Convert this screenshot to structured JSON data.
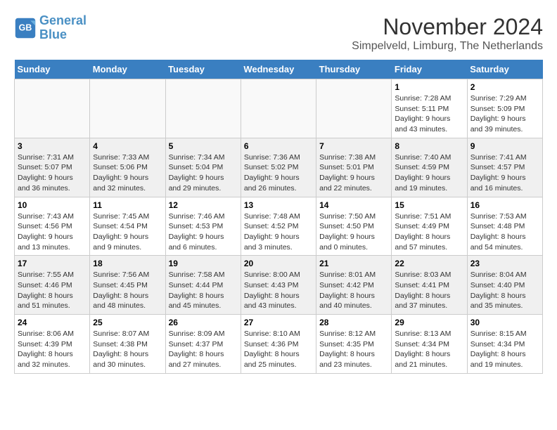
{
  "header": {
    "logo_line1": "General",
    "logo_line2": "Blue",
    "month_title": "November 2024",
    "location": "Simpelveld, Limburg, The Netherlands"
  },
  "weekdays": [
    "Sunday",
    "Monday",
    "Tuesday",
    "Wednesday",
    "Thursday",
    "Friday",
    "Saturday"
  ],
  "weeks": [
    [
      {
        "day": "",
        "info": ""
      },
      {
        "day": "",
        "info": ""
      },
      {
        "day": "",
        "info": ""
      },
      {
        "day": "",
        "info": ""
      },
      {
        "day": "",
        "info": ""
      },
      {
        "day": "1",
        "info": "Sunrise: 7:28 AM\nSunset: 5:11 PM\nDaylight: 9 hours\nand 43 minutes."
      },
      {
        "day": "2",
        "info": "Sunrise: 7:29 AM\nSunset: 5:09 PM\nDaylight: 9 hours\nand 39 minutes."
      }
    ],
    [
      {
        "day": "3",
        "info": "Sunrise: 7:31 AM\nSunset: 5:07 PM\nDaylight: 9 hours\nand 36 minutes."
      },
      {
        "day": "4",
        "info": "Sunrise: 7:33 AM\nSunset: 5:06 PM\nDaylight: 9 hours\nand 32 minutes."
      },
      {
        "day": "5",
        "info": "Sunrise: 7:34 AM\nSunset: 5:04 PM\nDaylight: 9 hours\nand 29 minutes."
      },
      {
        "day": "6",
        "info": "Sunrise: 7:36 AM\nSunset: 5:02 PM\nDaylight: 9 hours\nand 26 minutes."
      },
      {
        "day": "7",
        "info": "Sunrise: 7:38 AM\nSunset: 5:01 PM\nDaylight: 9 hours\nand 22 minutes."
      },
      {
        "day": "8",
        "info": "Sunrise: 7:40 AM\nSunset: 4:59 PM\nDaylight: 9 hours\nand 19 minutes."
      },
      {
        "day": "9",
        "info": "Sunrise: 7:41 AM\nSunset: 4:57 PM\nDaylight: 9 hours\nand 16 minutes."
      }
    ],
    [
      {
        "day": "10",
        "info": "Sunrise: 7:43 AM\nSunset: 4:56 PM\nDaylight: 9 hours\nand 13 minutes."
      },
      {
        "day": "11",
        "info": "Sunrise: 7:45 AM\nSunset: 4:54 PM\nDaylight: 9 hours\nand 9 minutes."
      },
      {
        "day": "12",
        "info": "Sunrise: 7:46 AM\nSunset: 4:53 PM\nDaylight: 9 hours\nand 6 minutes."
      },
      {
        "day": "13",
        "info": "Sunrise: 7:48 AM\nSunset: 4:52 PM\nDaylight: 9 hours\nand 3 minutes."
      },
      {
        "day": "14",
        "info": "Sunrise: 7:50 AM\nSunset: 4:50 PM\nDaylight: 9 hours\nand 0 minutes."
      },
      {
        "day": "15",
        "info": "Sunrise: 7:51 AM\nSunset: 4:49 PM\nDaylight: 8 hours\nand 57 minutes."
      },
      {
        "day": "16",
        "info": "Sunrise: 7:53 AM\nSunset: 4:48 PM\nDaylight: 8 hours\nand 54 minutes."
      }
    ],
    [
      {
        "day": "17",
        "info": "Sunrise: 7:55 AM\nSunset: 4:46 PM\nDaylight: 8 hours\nand 51 minutes."
      },
      {
        "day": "18",
        "info": "Sunrise: 7:56 AM\nSunset: 4:45 PM\nDaylight: 8 hours\nand 48 minutes."
      },
      {
        "day": "19",
        "info": "Sunrise: 7:58 AM\nSunset: 4:44 PM\nDaylight: 8 hours\nand 45 minutes."
      },
      {
        "day": "20",
        "info": "Sunrise: 8:00 AM\nSunset: 4:43 PM\nDaylight: 8 hours\nand 43 minutes."
      },
      {
        "day": "21",
        "info": "Sunrise: 8:01 AM\nSunset: 4:42 PM\nDaylight: 8 hours\nand 40 minutes."
      },
      {
        "day": "22",
        "info": "Sunrise: 8:03 AM\nSunset: 4:41 PM\nDaylight: 8 hours\nand 37 minutes."
      },
      {
        "day": "23",
        "info": "Sunrise: 8:04 AM\nSunset: 4:40 PM\nDaylight: 8 hours\nand 35 minutes."
      }
    ],
    [
      {
        "day": "24",
        "info": "Sunrise: 8:06 AM\nSunset: 4:39 PM\nDaylight: 8 hours\nand 32 minutes."
      },
      {
        "day": "25",
        "info": "Sunrise: 8:07 AM\nSunset: 4:38 PM\nDaylight: 8 hours\nand 30 minutes."
      },
      {
        "day": "26",
        "info": "Sunrise: 8:09 AM\nSunset: 4:37 PM\nDaylight: 8 hours\nand 27 minutes."
      },
      {
        "day": "27",
        "info": "Sunrise: 8:10 AM\nSunset: 4:36 PM\nDaylight: 8 hours\nand 25 minutes."
      },
      {
        "day": "28",
        "info": "Sunrise: 8:12 AM\nSunset: 4:35 PM\nDaylight: 8 hours\nand 23 minutes."
      },
      {
        "day": "29",
        "info": "Sunrise: 8:13 AM\nSunset: 4:34 PM\nDaylight: 8 hours\nand 21 minutes."
      },
      {
        "day": "30",
        "info": "Sunrise: 8:15 AM\nSunset: 4:34 PM\nDaylight: 8 hours\nand 19 minutes."
      }
    ]
  ]
}
